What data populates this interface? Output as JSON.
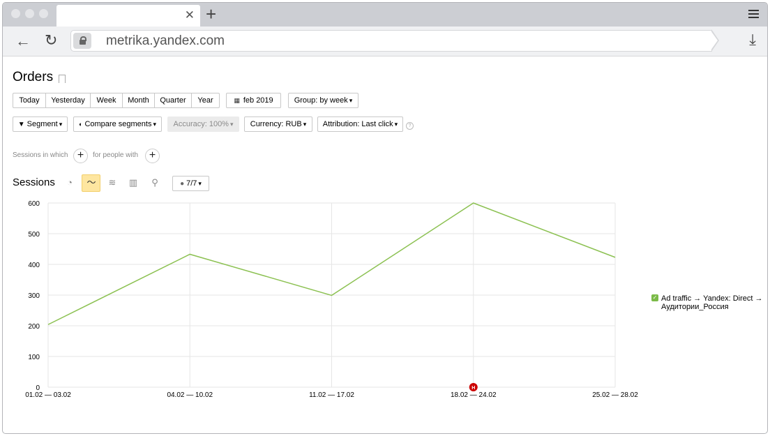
{
  "browser": {
    "url": "metrika.yandex.com",
    "tab_title": ""
  },
  "report": {
    "title": "Orders",
    "periods": [
      "Today",
      "Yesterday",
      "Week",
      "Month",
      "Quarter",
      "Year"
    ],
    "date_range": "feb 2019",
    "grouping": "Group: by week",
    "segment": "Segment",
    "compare_segments": "Compare segments",
    "accuracy": "Accuracy: 100%",
    "currency": "Currency: RUB",
    "attribution": "Attribution: Last click",
    "sessions_in_which": "Sessions in which",
    "for_people_with": "for people with"
  },
  "chart_section": {
    "title": "Sessions",
    "series_count": "7/7",
    "marker_label": "Н"
  },
  "colors": {
    "line": "#8cc152",
    "grid": "#e6e6e6",
    "marker": "#cc0000",
    "active_viz": "#fee6a0"
  },
  "chart_data": {
    "type": "line",
    "categories": [
      "01.02 — 03.02",
      "04.02 — 10.02",
      "11.02 — 17.02",
      "18.02 — 24.02",
      "25.02 — 28.02"
    ],
    "series": [
      {
        "name": "Ad traffic → Yandex: Direct → Аудитории_Россия",
        "values": [
          204,
          433,
          299,
          600,
          423
        ]
      }
    ],
    "yticks": [
      0,
      100,
      200,
      300,
      400,
      500,
      600
    ],
    "ylim": [
      0,
      600
    ],
    "grid": true,
    "legend_position": "right"
  }
}
